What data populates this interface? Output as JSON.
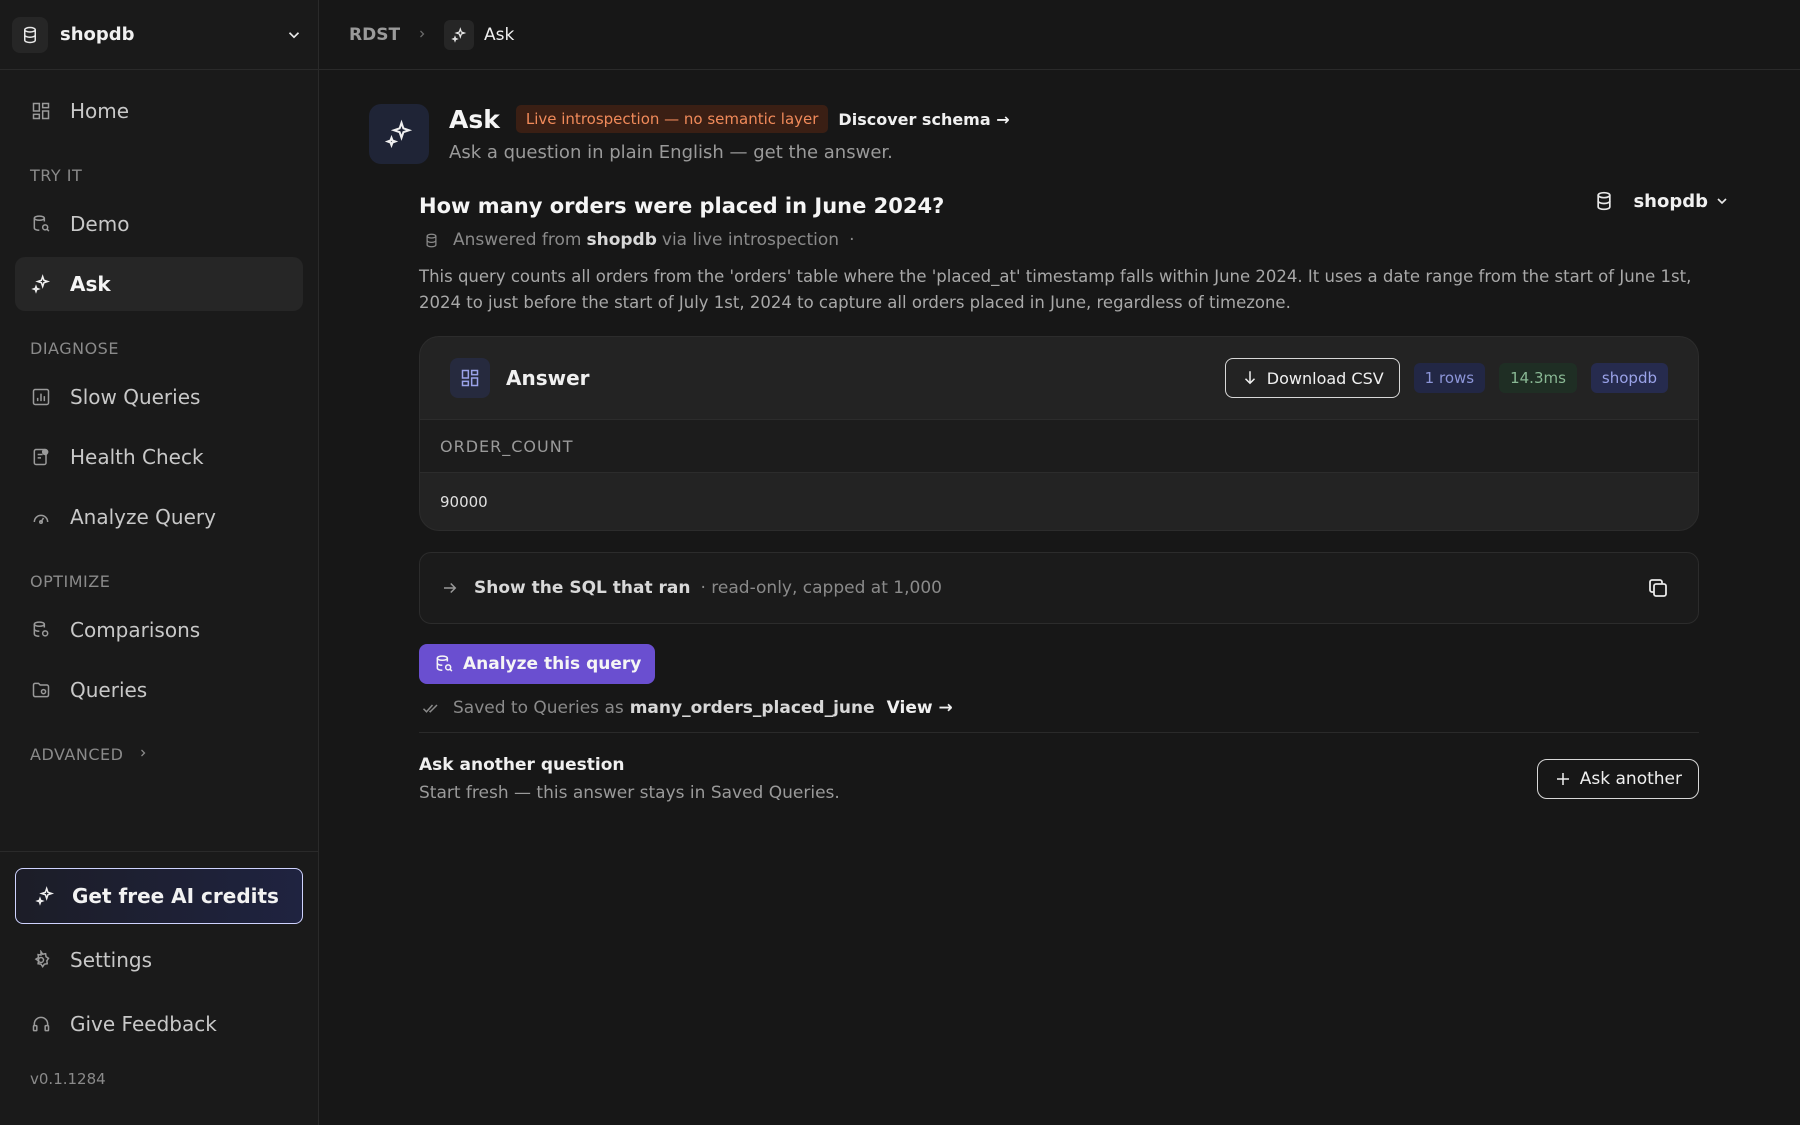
{
  "sidebar": {
    "db_name": "shopdb",
    "items": {
      "home": "Home",
      "demo": "Demo",
      "ask": "Ask",
      "slow_queries": "Slow Queries",
      "health_check": "Health Check",
      "analyze_query": "Analyze Query",
      "comparisons": "Comparisons",
      "queries": "Queries"
    },
    "sections": {
      "try_it": "TRY IT",
      "diagnose": "DIAGNOSE",
      "optimize": "OPTIMIZE",
      "advanced": "ADVANCED"
    },
    "credits_label": "Get free AI credits",
    "settings": "Settings",
    "feedback": "Give Feedback",
    "version": "v0.1.1284"
  },
  "breadcrumb": {
    "root": "RDST",
    "current": "Ask"
  },
  "header": {
    "title": "Ask",
    "badge": "Live introspection — no semantic layer",
    "discover": "Discover schema →",
    "subtitle": "Ask a question in plain English — get the answer.",
    "db_select": "shopdb"
  },
  "answer": {
    "question": "How many orders were placed in June 2024?",
    "answered_prefix": "Answered from",
    "answered_db": "shopdb",
    "answered_suffix": "via live introspection",
    "answered_dot": "·",
    "explanation": "This query counts all orders from the 'orders' table where the 'placed_at' timestamp falls within June 2024. It uses a date range from the start of June 1st, 2024 to just before the start of July 1st, 2024 to capture all orders placed in June, regardless of timezone.",
    "card_label": "Answer",
    "download": "Download CSV",
    "rows": "1 rows",
    "time": "14.3ms",
    "db": "shopdb",
    "column": "ORDER_COUNT",
    "value": "90000"
  },
  "sql": {
    "label": "Show the SQL that ran",
    "meta": "· read-only, capped at 1,000"
  },
  "actions": {
    "analyze": "Analyze this query",
    "saved_prefix": "Saved to Queries as",
    "saved_name": "many_orders_placed_june",
    "view": "View →"
  },
  "another": {
    "heading": "Ask another question",
    "sub": "Start fresh — this answer stays in Saved Queries.",
    "button": "Ask another"
  },
  "colors": {
    "accent": "#6a4fd0",
    "badge_text": "#f08a5a",
    "badge_bg": "#3a1f14"
  }
}
